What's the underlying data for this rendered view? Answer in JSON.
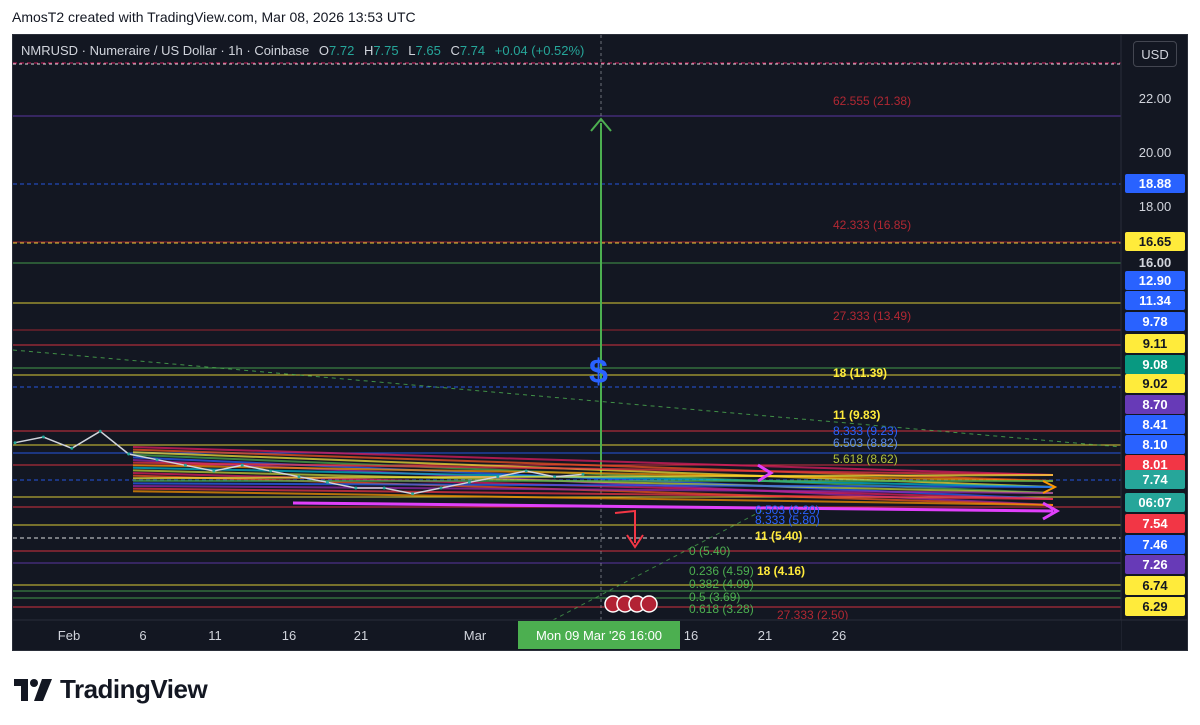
{
  "header": {
    "caption": "AmosT2 created with TradingView.com, Mar 08, 2026 13:53 UTC"
  },
  "legend": {
    "symbol": "NMRUSD · Numeraire / US Dollar · 1h · Coinbase",
    "open_label": "O",
    "open": "7.72",
    "high_label": "H",
    "high": "7.75",
    "low_label": "L",
    "low": "7.65",
    "close_label": "C",
    "close": "7.74",
    "change": "+0.04 (+0.52%)"
  },
  "currency_button": "USD",
  "footer": {
    "brand": "TradingView"
  },
  "colors": {
    "background": "#131722",
    "up": "#26a69a",
    "grid": "#2a2e39",
    "text": "#d1d4dc",
    "crosshair_label": "#4caf50"
  },
  "chart_data": {
    "type": "line",
    "title": "NMRUSD · Numeraire / US Dollar · 1h · Coinbase",
    "y_axis": {
      "side": "right",
      "ticks": [
        22.0,
        20.0,
        18.0,
        16.0
      ]
    },
    "x_axis": {
      "ticks": [
        "Feb",
        "6",
        "11",
        "16",
        "21",
        "Mar",
        "16",
        "21",
        "26"
      ],
      "crosshair_label": "Mon 09 Mar '26   16:00"
    },
    "price_series": {
      "name": "NMRUSD",
      "x": [
        "Jan 28",
        "Jan 30",
        "Feb 01",
        "Feb 03",
        "Feb 05",
        "Feb 07",
        "Feb 09",
        "Feb 11",
        "Feb 13",
        "Feb 15",
        "Feb 17",
        "Feb 19",
        "Feb 21",
        "Feb 23",
        "Feb 25",
        "Feb 27",
        "Mar 01",
        "Mar 03",
        "Mar 05",
        "Mar 07",
        "Mar 08"
      ],
      "y": [
        8.3,
        8.4,
        8.2,
        8.5,
        8.1,
        8.0,
        7.9,
        7.8,
        7.9,
        7.8,
        7.7,
        7.6,
        7.5,
        7.5,
        7.4,
        7.5,
        7.6,
        7.7,
        7.8,
        7.7,
        7.74
      ]
    },
    "price_labels": [
      {
        "value": "18.88",
        "color": "#2962ff",
        "text_color": "#ffffff"
      },
      {
        "value": "16.65",
        "color": "#ffeb3b",
        "text_color": "#131722"
      },
      {
        "value": "16.00",
        "color": "#131722",
        "text_color": "#d1d4dc"
      },
      {
        "value": "12.90",
        "color": "#2962ff",
        "text_color": "#ffffff"
      },
      {
        "value": "11.34",
        "color": "#2962ff",
        "text_color": "#ffffff"
      },
      {
        "value": "9.78",
        "color": "#2962ff",
        "text_color": "#ffffff"
      },
      {
        "value": "9.11",
        "color": "#ffeb3b",
        "text_color": "#131722"
      },
      {
        "value": "9.08",
        "color": "#089981",
        "text_color": "#ffffff"
      },
      {
        "value": "9.02",
        "color": "#ffeb3b",
        "text_color": "#131722"
      },
      {
        "value": "8.70",
        "color": "#673ab7",
        "text_color": "#ffffff"
      },
      {
        "value": "8.41",
        "color": "#2962ff",
        "text_color": "#ffffff"
      },
      {
        "value": "8.10",
        "color": "#2962ff",
        "text_color": "#ffffff"
      },
      {
        "value": "8.01",
        "color": "#f23645",
        "text_color": "#ffffff"
      },
      {
        "value": "7.74",
        "color": "#26a69a",
        "text_color": "#ffffff"
      },
      {
        "value": "06:07",
        "color": "#26a69a",
        "text_color": "#ffffff"
      },
      {
        "value": "7.54",
        "color": "#f23645",
        "text_color": "#ffffff"
      },
      {
        "value": "7.46",
        "color": "#2962ff",
        "text_color": "#ffffff"
      },
      {
        "value": "7.26",
        "color": "#673ab7",
        "text_color": "#ffffff"
      },
      {
        "value": "6.74",
        "color": "#ffeb3b",
        "text_color": "#131722"
      },
      {
        "value": "6.29",
        "color": "#ffeb3b",
        "text_color": "#131722"
      }
    ],
    "annotations": [
      {
        "text": "62.555 (21.38)",
        "color": "#b22833"
      },
      {
        "text": "42.333 (16.85)",
        "color": "#b22833"
      },
      {
        "text": "27.333 (13.49)",
        "color": "#b22833"
      },
      {
        "text": "18 (11.39)",
        "color": "#ffeb3b"
      },
      {
        "text": "11 (9.83)",
        "color": "#ffeb3b"
      },
      {
        "text": "8.333 (9.23)",
        "color": "#2962ff"
      },
      {
        "text": "6.503 (8.82)",
        "color": "#5b8def"
      },
      {
        "text": "5.618 (8.62)",
        "color": "#b2c23a"
      },
      {
        "text": "6.503 (6.20)",
        "color": "#2962ff"
      },
      {
        "text": "8.333 (5.80)",
        "color": "#2962ff"
      },
      {
        "text": "11 (5.40)",
        "color": "#ffeb3b"
      },
      {
        "text": "0 (5.40)",
        "color": "#4caf50"
      },
      {
        "text": "0.236 (4.59)",
        "color": "#4caf50"
      },
      {
        "text": "18 (4.16)",
        "color": "#ffeb3b"
      },
      {
        "text": "0.382 (4.09)",
        "color": "#4caf50"
      },
      {
        "text": "0.5 (3.69)",
        "color": "#4caf50"
      },
      {
        "text": "0.618 (3.28)",
        "color": "#4caf50"
      },
      {
        "text": "27.333 (2.50)",
        "color": "#b22833"
      },
      {
        "text": "$",
        "color": "#2962ff"
      }
    ],
    "grid": false,
    "legend_position": "top-left"
  }
}
